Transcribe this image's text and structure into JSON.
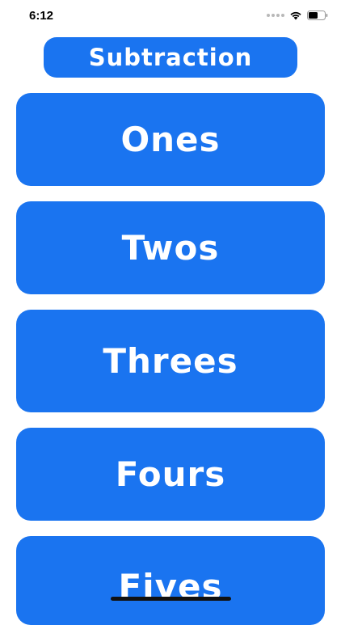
{
  "status_bar": {
    "time": "6:12",
    "icons": [
      "cellular-signal-icon",
      "wifi-icon",
      "battery-icon"
    ]
  },
  "header": {
    "title": "Subtraction"
  },
  "menu": {
    "items": [
      {
        "label": "Ones"
      },
      {
        "label": "Twos"
      },
      {
        "label": "Threes"
      },
      {
        "label": "Fours"
      },
      {
        "label": "Fives"
      }
    ]
  },
  "colors": {
    "button_blue": "#1a74f0",
    "button_text": "#ffffff",
    "background": "#ffffff"
  }
}
